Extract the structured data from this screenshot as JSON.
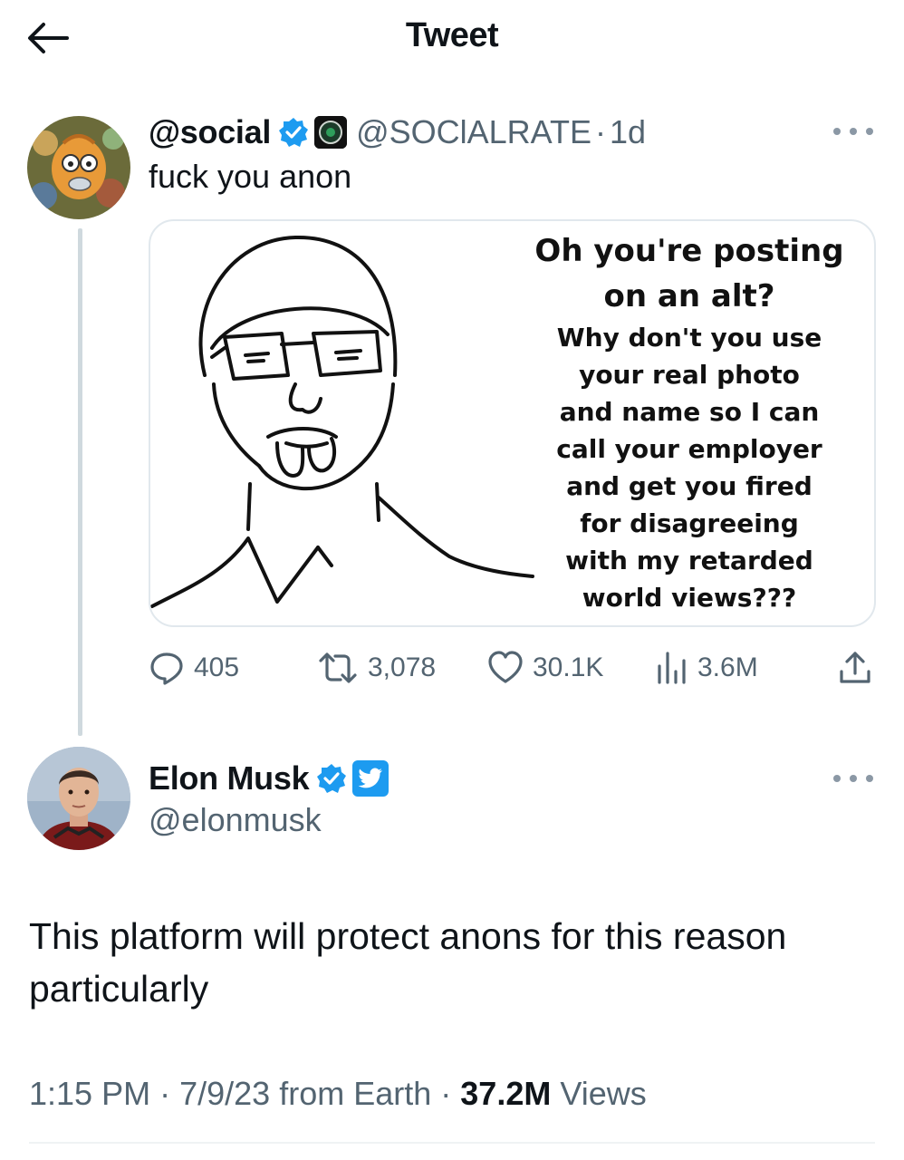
{
  "header": {
    "title": "Tweet",
    "back_icon": "arrow-left-icon"
  },
  "quoted_tweet": {
    "display_name": "@social",
    "handle": "@SOClALRATE",
    "separator": "·",
    "time_ago": "1d",
    "text": "fuck you anon",
    "verified_color": "#1d9bf0",
    "media": {
      "caption_line1": "Oh you're posting",
      "caption_line2": "on an alt?",
      "caption_body": [
        "Why don't you use",
        "your real photo",
        "and name so I can",
        "call your employer",
        "and get you fired",
        "for disagreeing",
        "with my retarded",
        "world views???"
      ]
    },
    "actions": {
      "replies": "405",
      "retweets": "3,078",
      "likes": "30.1K",
      "views": "3.6M"
    }
  },
  "main_tweet": {
    "display_name": "Elon Musk",
    "handle": "@elonmusk",
    "text": "This platform will protect anons for this reason particularly",
    "time": "1:15 PM",
    "sep1": "·",
    "date": "7/9/23 from Earth",
    "sep2": "·",
    "views_count": "37.2M",
    "views_label": "Views",
    "affiliation_color": "#1d9bf0"
  }
}
